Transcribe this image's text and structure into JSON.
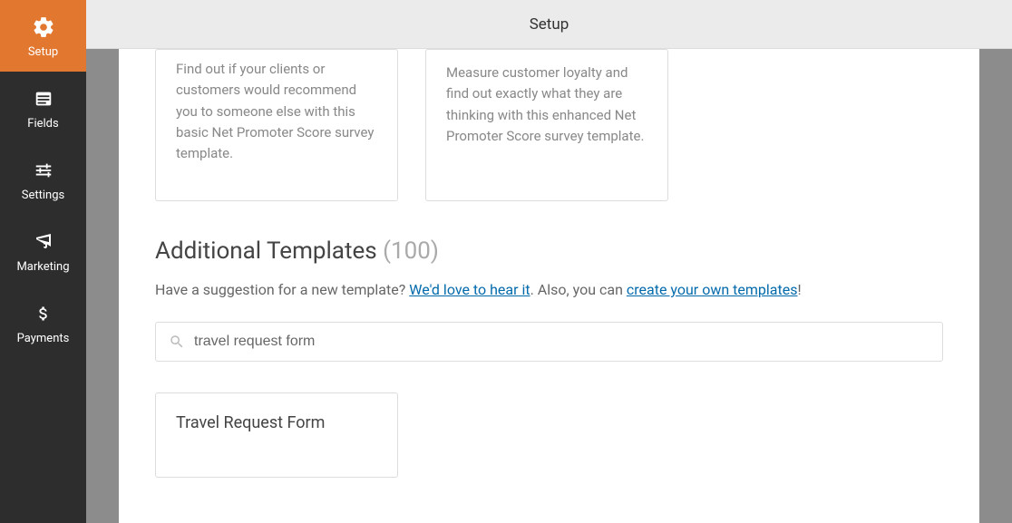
{
  "header": {
    "title": "Setup"
  },
  "sidebar": {
    "items": [
      {
        "label": "Setup",
        "active": true
      },
      {
        "label": "Fields",
        "active": false
      },
      {
        "label": "Settings",
        "active": false
      },
      {
        "label": "Marketing",
        "active": false
      },
      {
        "label": "Payments",
        "active": false
      }
    ]
  },
  "template_cards": [
    {
      "title_visible": "",
      "description": "Find out if your clients or customers would recommend you to someone else with this basic Net Promoter Score survey template."
    },
    {
      "title_visible": "",
      "description": "Measure customer loyalty and find out exactly what they are thinking with this enhanced Net Promoter Score survey template."
    }
  ],
  "additional": {
    "heading": "Additional Templates",
    "count": "(100)",
    "suggestion_prefix": "Have a suggestion for a new template? ",
    "suggestion_link1": "We'd love to hear it",
    "suggestion_mid": ". Also, you can ",
    "suggestion_link2": "create your own templates",
    "suggestion_suffix": "!"
  },
  "search": {
    "value": "travel request form"
  },
  "results": [
    {
      "title": "Travel Request Form"
    }
  ]
}
